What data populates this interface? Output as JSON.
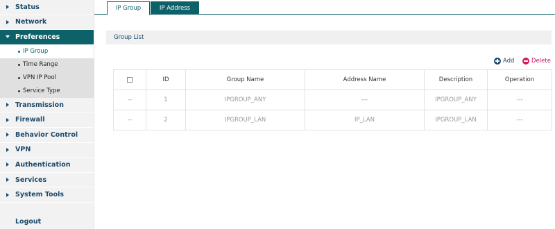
{
  "sidebar": {
    "items": [
      {
        "label": "Status"
      },
      {
        "label": "Network"
      },
      {
        "label": "Preferences",
        "expanded": true
      },
      {
        "label": "Transmission"
      },
      {
        "label": "Firewall"
      },
      {
        "label": "Behavior Control"
      },
      {
        "label": "VPN"
      },
      {
        "label": "Authentication"
      },
      {
        "label": "Services"
      },
      {
        "label": "System Tools"
      }
    ],
    "sub_items": [
      {
        "label": "IP Group",
        "active": true
      },
      {
        "label": "Time Range"
      },
      {
        "label": "VPN IP Pool"
      },
      {
        "label": "Service Type"
      }
    ],
    "logout": "Logout"
  },
  "tabs": [
    {
      "label": "IP Group",
      "active": true
    },
    {
      "label": "IP Address"
    }
  ],
  "section": {
    "title": "Group List",
    "add_label": "Add",
    "delete_label": "Delete"
  },
  "table": {
    "headers": [
      "ID",
      "Group Name",
      "Address Name",
      "Description",
      "Operation"
    ],
    "rows": [
      {
        "select": "--",
        "id": "1",
        "group_name": "IPGROUP_ANY",
        "address_name": "---",
        "description": "IPGROUP_ANY",
        "operation": "---"
      },
      {
        "select": "--",
        "id": "2",
        "group_name": "IPGROUP_LAN",
        "address_name": "IP_LAN",
        "description": "IPGROUP_LAN",
        "operation": "---"
      }
    ]
  },
  "colors": {
    "accent": "#0d6169",
    "nav_text": "#1d4a6b",
    "delete": "#d81b60"
  }
}
